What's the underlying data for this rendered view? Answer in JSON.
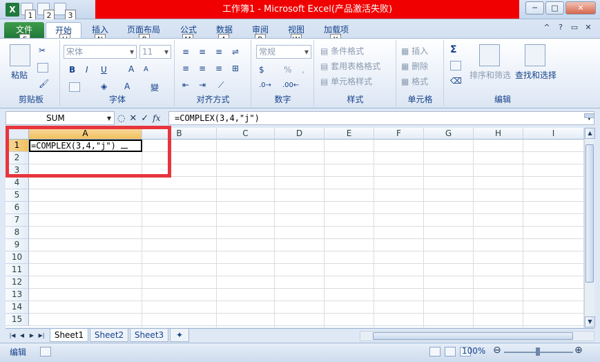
{
  "window": {
    "title": "工作簿1 - Microsoft Excel(产品激活失败)",
    "controls": [
      "─",
      "□",
      "✕"
    ]
  },
  "qat_keytips": [
    "1",
    "2",
    "3"
  ],
  "tabs": [
    {
      "label": "文件",
      "keytip": "F"
    },
    {
      "label": "开始",
      "keytip": "H"
    },
    {
      "label": "插入",
      "keytip": "N"
    },
    {
      "label": "页面布局",
      "keytip": "P"
    },
    {
      "label": "公式",
      "keytip": "M"
    },
    {
      "label": "数据",
      "keytip": "A"
    },
    {
      "label": "审阅",
      "keytip": "R"
    },
    {
      "label": "视图",
      "keytip": "W"
    },
    {
      "label": "加载项",
      "keytip": "X"
    }
  ],
  "ribbon": {
    "clipboard": {
      "paste": "粘贴",
      "label": "剪贴板"
    },
    "font": {
      "font_name": "宋体",
      "font_size": "11",
      "label": "字体",
      "bold": "B",
      "italic": "I",
      "underline": "U"
    },
    "alignment": {
      "label": "对齐方式"
    },
    "number": {
      "format": "常规",
      "percent": "%",
      "comma": ",",
      "label": "数字"
    },
    "styles": {
      "conditional": "条件格式",
      "table": "套用表格格式",
      "cell": "单元格样式",
      "label": "样式"
    },
    "cells": {
      "insert": "插入",
      "delete": "删除",
      "format": "格式",
      "label": "单元格"
    },
    "editing": {
      "sort": "排序和筛选",
      "find": "查找和选择",
      "label": "编辑"
    }
  },
  "formula_bar": {
    "name_box": "SUM",
    "formula": "=COMPLEX(3,4,\"j\")"
  },
  "grid": {
    "columns": [
      "A",
      "B",
      "C",
      "D",
      "E",
      "F",
      "G",
      "H",
      "I"
    ],
    "rows": [
      "1",
      "2",
      "3",
      "4",
      "5",
      "6",
      "7",
      "8",
      "9",
      "10",
      "11",
      "12",
      "13",
      "14",
      "15"
    ],
    "cell_A1": "=COMPLEX(3,4,\"j\")"
  },
  "sheets": [
    "Sheet1",
    "Sheet2",
    "Sheet3"
  ],
  "status": {
    "mode": "编辑",
    "zoom": "100%"
  },
  "highlight_color": "#e8353d"
}
